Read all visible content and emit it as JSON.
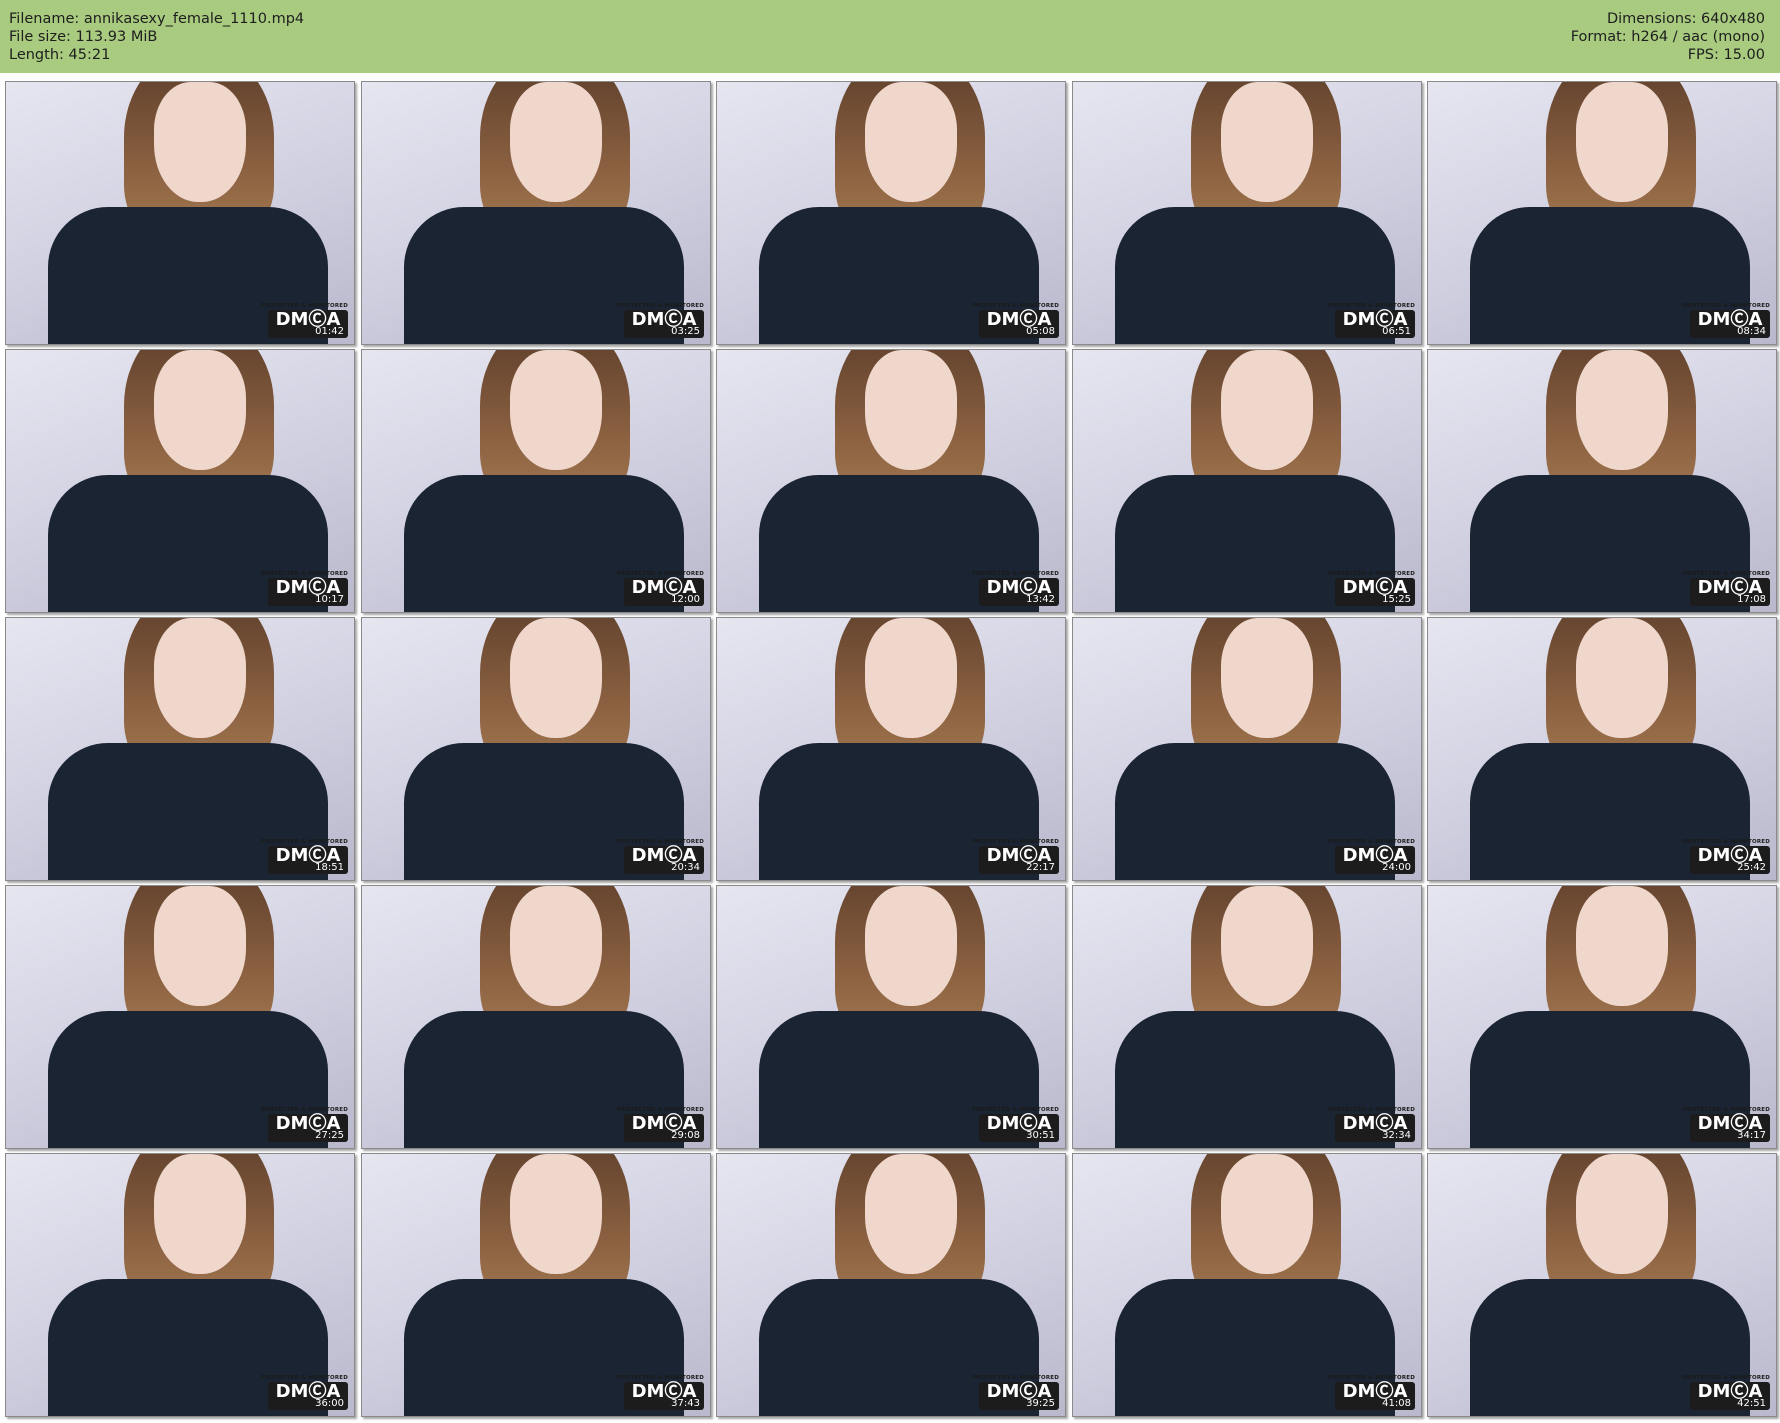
{
  "header": {
    "filename": "Filename: annikasexy_female_1110.mp4",
    "filesize": "File size: 113.93 MiB",
    "length": "Length: 45:21",
    "dimensions": "Dimensions: 640x480",
    "format": "Format: h264 / aac (mono)",
    "fps": "FPS: 15.00"
  },
  "badge": {
    "protected": "PROTECTED & MONITORED",
    "dmca": "DMⒸA"
  },
  "thumbnails": [
    {
      "time": "01:42"
    },
    {
      "time": "03:25"
    },
    {
      "time": "05:08"
    },
    {
      "time": "06:51"
    },
    {
      "time": "08:34"
    },
    {
      "time": "10:17"
    },
    {
      "time": "12:00"
    },
    {
      "time": "13:42"
    },
    {
      "time": "15:25"
    },
    {
      "time": "17:08"
    },
    {
      "time": "18:51"
    },
    {
      "time": "20:34"
    },
    {
      "time": "22:17"
    },
    {
      "time": "24:00"
    },
    {
      "time": "25:42"
    },
    {
      "time": "27:25"
    },
    {
      "time": "29:08"
    },
    {
      "time": "30:51"
    },
    {
      "time": "32:34"
    },
    {
      "time": "34:17"
    },
    {
      "time": "36:00"
    },
    {
      "time": "37:43"
    },
    {
      "time": "39:25"
    },
    {
      "time": "41:08"
    },
    {
      "time": "42:51"
    }
  ]
}
